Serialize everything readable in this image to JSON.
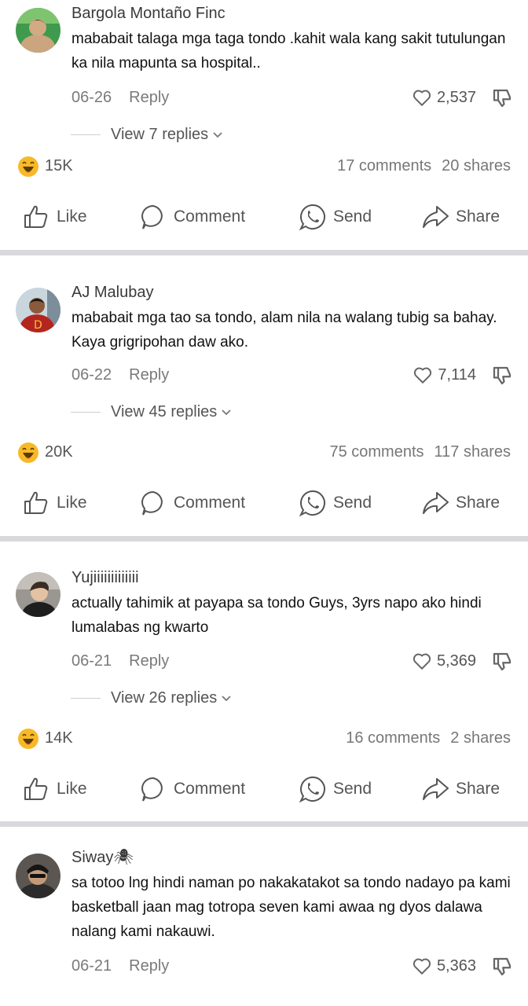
{
  "posts": [
    {
      "author": "Bargola Montaño Finc",
      "text": "mababait talaga mga taga tondo .kahit wala kang sakit tutulungan ka nila mapunta sa hospital..",
      "date": "06-26",
      "reply_label": "Reply",
      "likes": "2,537",
      "view_replies": "View 7 replies",
      "reactions": "15K",
      "comments": "17 comments",
      "shares": "20 shares"
    },
    {
      "author": "AJ Malubay",
      "text": "mababait mga tao sa tondo, alam nila na walang tubig sa bahay. Kaya grigripohan daw ako.",
      "date": "06-22",
      "reply_label": "Reply",
      "likes": "7,114",
      "view_replies": "View 45 replies",
      "reactions": "20K",
      "comments": "75 comments",
      "shares": "117 shares"
    },
    {
      "author": "Yujiiiiiiiiiiiii",
      "text": "actually tahimik at payapa sa tondo Guys, 3yrs napo ako hindi lumalabas ng kwarto",
      "date": "06-21",
      "reply_label": "Reply",
      "likes": "5,369",
      "view_replies": "View 26 replies",
      "reactions": "14K",
      "comments": "16 comments",
      "shares": "2 shares"
    },
    {
      "author": "Siway🕷",
      "text": "sa totoo lng hindi naman po nakakatakot sa tondo nadayo pa kami basketball jaan mag totropa seven kami awaa ng dyos dalawa nalang kami nakauwi.",
      "date": "06-21",
      "reply_label": "Reply",
      "likes": "5,363"
    }
  ],
  "actions": {
    "like": "Like",
    "comment": "Comment",
    "send": "Send",
    "share": "Share"
  },
  "icons": {
    "like": "heart-outline-icon",
    "dislike": "thumbs-down-icon",
    "reaction": "laughing-emoji-icon",
    "action_like": "thumbs-up-icon",
    "action_comment": "speech-bubble-icon",
    "action_send": "whatsapp-icon",
    "action_share": "share-arrow-icon"
  },
  "colors": {
    "separator": "#d9d9dc",
    "meta_text": "#7a7a7a",
    "emoji_yellow": "#f7b928"
  }
}
